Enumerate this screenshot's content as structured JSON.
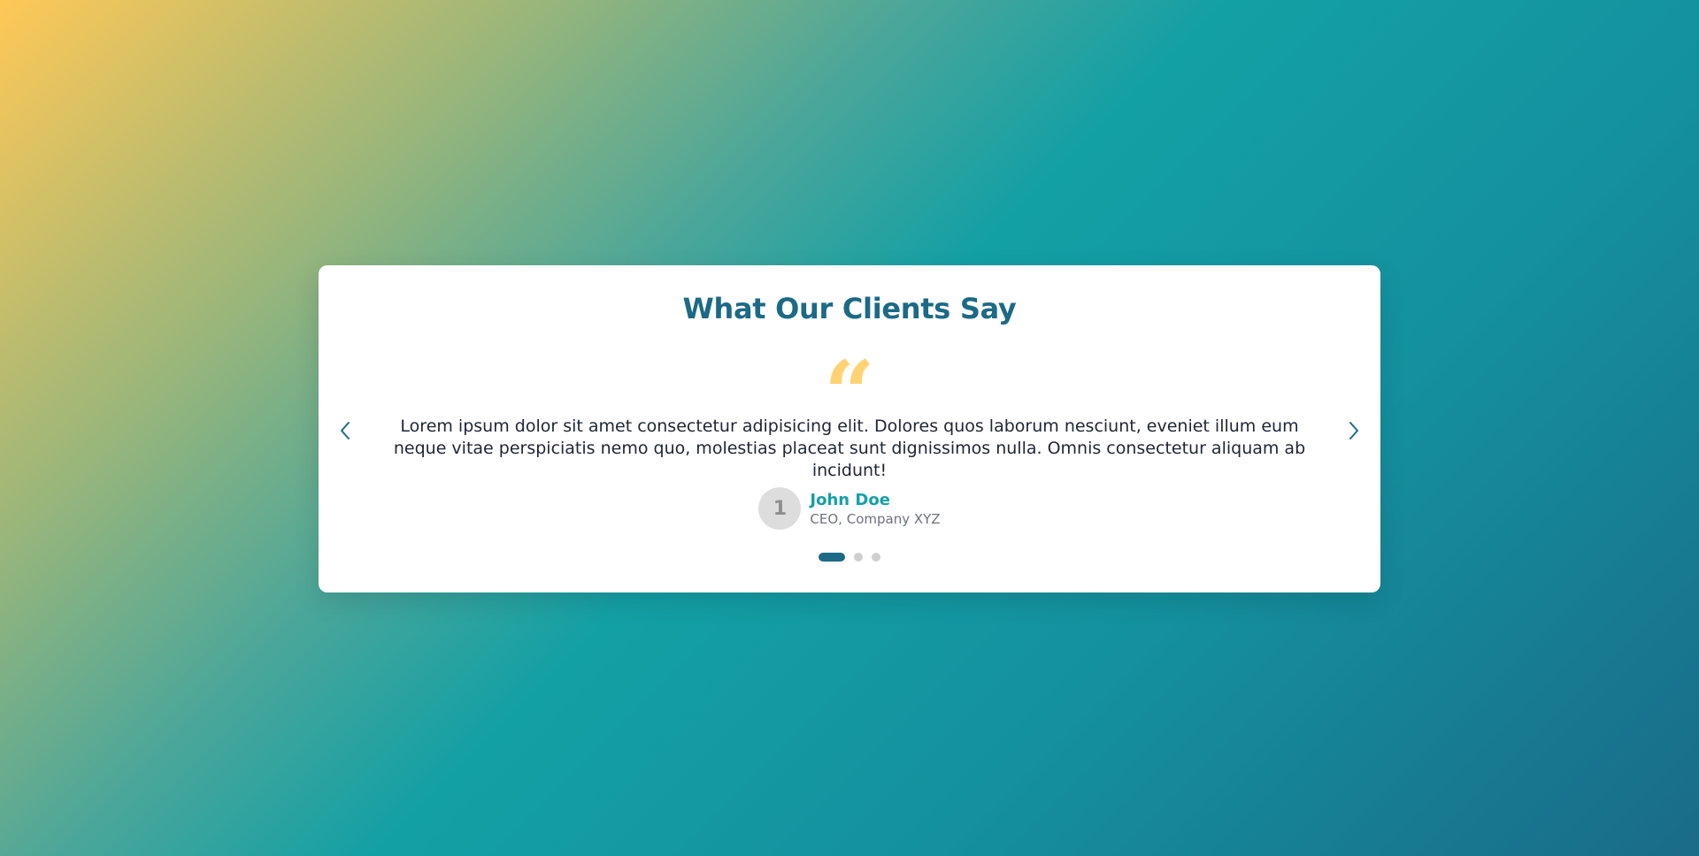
{
  "testimonials": {
    "title": "What Our Clients Say",
    "quote_icon": "quote-icon",
    "quote_text": "Lorem ipsum dolor sit amet consectetur adipisicing elit. Dolores quos laborum nesciunt, eveniet illum eum neque vitae perspiciatis nemo quo, molestias placeat sunt dignissimos nulla. Omnis consectetur aliquam ab incidunt!",
    "author": {
      "avatar_text": "1",
      "name": "John Doe",
      "role": "CEO, Company XYZ"
    },
    "slides_total": 3,
    "active_slide": 1,
    "prev_icon": "chevron-left-icon",
    "next_icon": "chevron-right-icon"
  },
  "colors": {
    "accent": "#1c6a85",
    "name": "#16a0a8",
    "quote": "#ffd373",
    "gradient_start": "#ffc857",
    "gradient_mid": "#13a0a5",
    "gradient_end": "#1a6b88"
  }
}
